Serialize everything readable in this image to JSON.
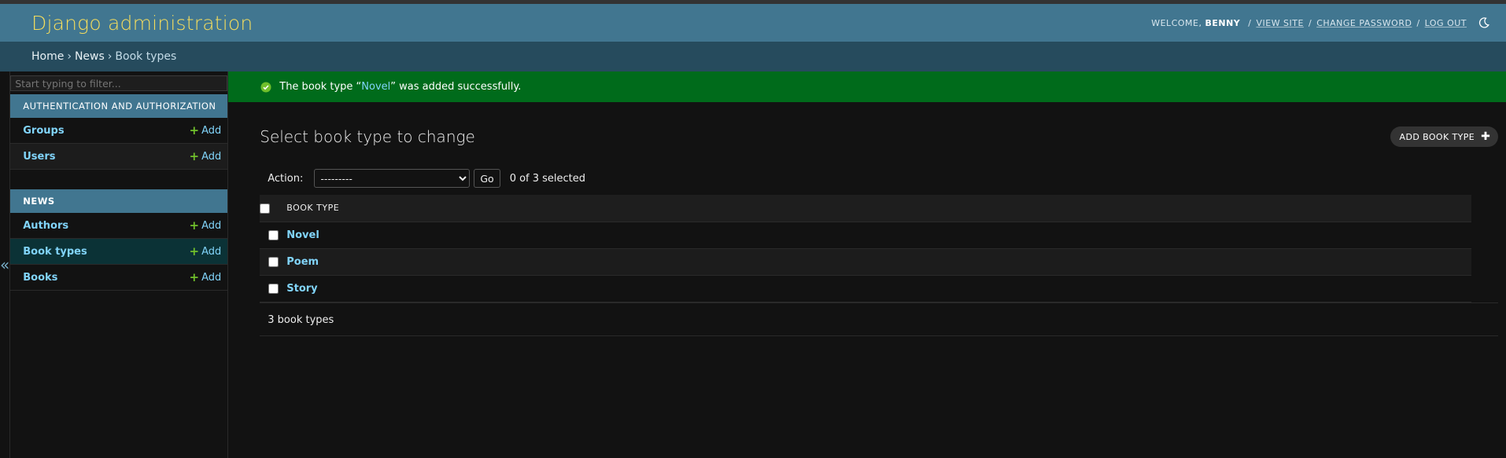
{
  "header": {
    "branding": "Django administration",
    "welcome": "WELCOME,",
    "username": "BENNY",
    "view_site": "VIEW SITE",
    "change_password": "CHANGE PASSWORD",
    "log_out": "LOG OUT",
    "separator": "/",
    "theme_icon": "moon-icon"
  },
  "breadcrumbs": {
    "home": "Home",
    "news": "News",
    "current": "Book types",
    "separator": "›"
  },
  "sidebar": {
    "toggle": "«",
    "filter_placeholder": "Start typing to filter...",
    "modules": [
      {
        "caption": "Authentication and Authorization",
        "models": [
          {
            "name": "Groups",
            "add": "Add"
          },
          {
            "name": "Users",
            "add": "Add"
          }
        ]
      },
      {
        "caption": "News",
        "models": [
          {
            "name": "Authors",
            "add": "Add"
          },
          {
            "name": "Book types",
            "add": "Add"
          },
          {
            "name": "Books",
            "add": "Add"
          }
        ]
      }
    ]
  },
  "message": {
    "prefix": "The book type “",
    "link": "Novel",
    "suffix": "” was added successfully."
  },
  "content": {
    "title": "Select book type to change",
    "add_button": "ADD BOOK TYPE",
    "action_label": "Action:",
    "action_selected": "---------",
    "go": "Go",
    "selected_count": "0 of 3 selected",
    "column_header": "BOOK TYPE",
    "rows": [
      "Novel",
      "Poem",
      "Story"
    ],
    "paginator": "3 book types"
  },
  "colors": {
    "header_bg": "#417690",
    "breadcrumbs_bg": "#264b5d",
    "branding": "#f5dd5d",
    "success_bg": "#006b1b",
    "link": "#81d4fa",
    "add_plus": "#70bf2b"
  }
}
